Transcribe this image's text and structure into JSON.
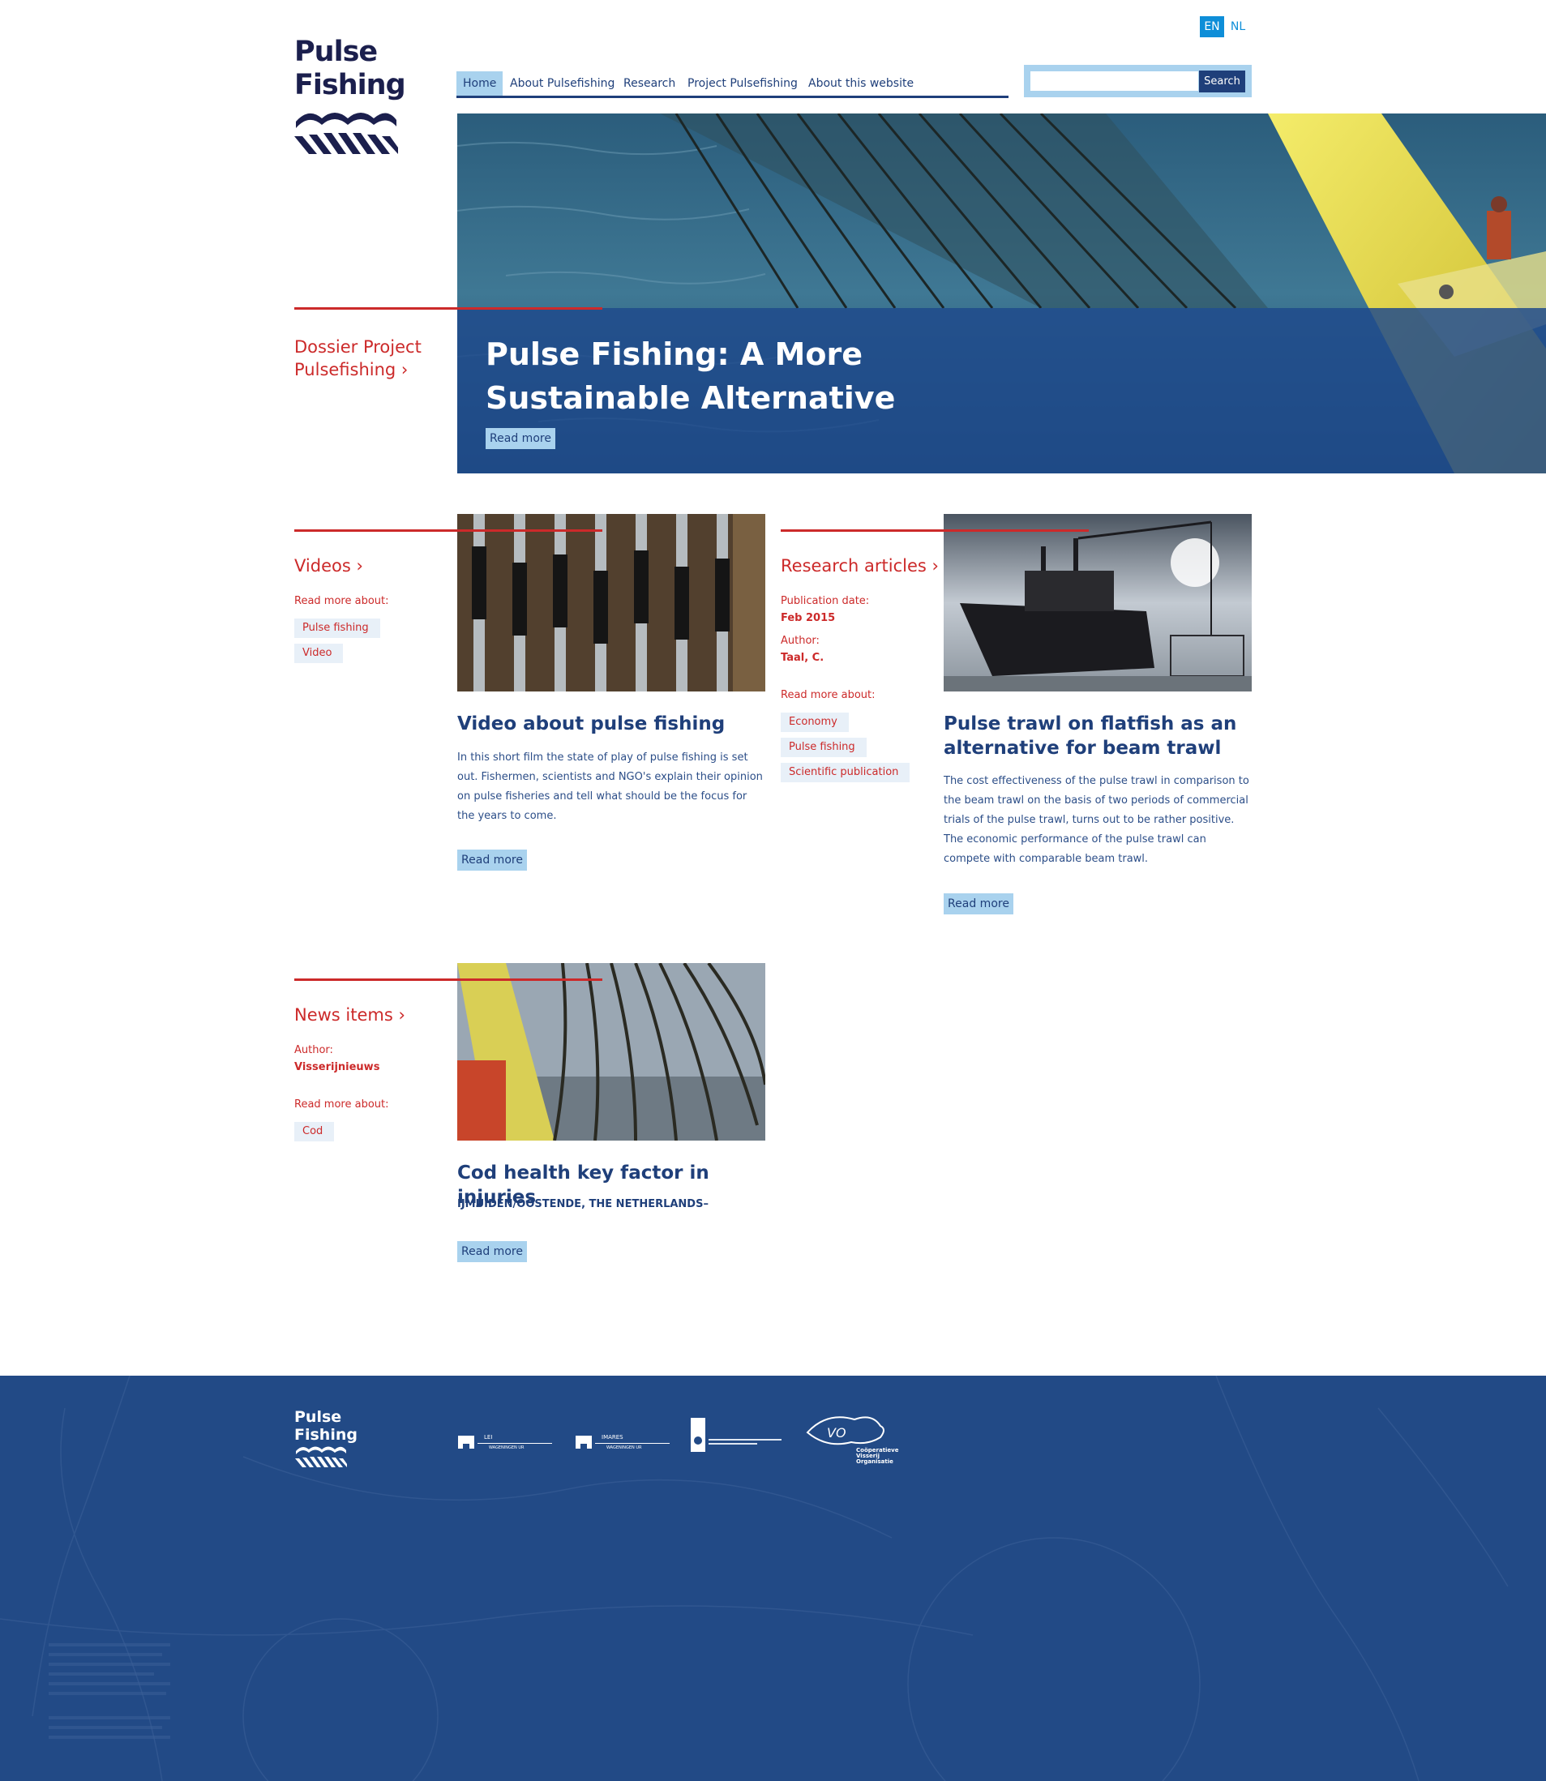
{
  "site": {
    "logo_line1": "Pulse",
    "logo_line2": "Fishing"
  },
  "language": {
    "en": "EN",
    "nl": "NL",
    "active": "EN"
  },
  "nav": {
    "items": [
      {
        "label": "Home",
        "active": true
      },
      {
        "label": "About Pulsefishing"
      },
      {
        "label": "Research"
      },
      {
        "label": "Project Pulsefishing"
      },
      {
        "label": "About this website"
      }
    ]
  },
  "search": {
    "value": "",
    "button_label": "Search"
  },
  "hero": {
    "side_link": "Dossier Project Pulsefishing ›",
    "title_line1": "Pulse Fishing: A More",
    "title_line2": "Sustainable Alternative",
    "read_more": "Read more"
  },
  "videos": {
    "heading": "Videos ›",
    "read_more_about_label": "Read more about:",
    "tags": [
      "Pulse fishing",
      "Video"
    ],
    "title": "Video about pulse fishing",
    "text": "In this short film the state of play of pulse fishing is set out. Fishermen, scientists and NGO's explain their opinion on pulse fisheries and tell what should be the focus for the years to come.",
    "read_more": "Read more"
  },
  "research": {
    "heading": "Research articles ›",
    "publication_date_label": "Publication date:",
    "publication_date": "Feb 2015",
    "author_label": "Author:",
    "author": "Taal, C.",
    "read_more_about_label": "Read more about:",
    "tags": [
      "Economy",
      "Pulse fishing",
      "Scientific publication"
    ],
    "title_line1": "Pulse trawl on flatfish as an",
    "title_line2": "alternative for beam trawl",
    "text": "The cost effectiveness of the pulse trawl in comparison to the beam trawl on the basis of two periods of commercial trials of the pulse trawl, turns out to be rather positive. The economic performance of the pulse trawl can compete with comparable beam trawl.",
    "read_more": "Read more"
  },
  "news": {
    "heading": "News items ›",
    "author_label": "Author:",
    "author": "Visserijnieuws",
    "read_more_about_label": "Read more about:",
    "tags": [
      "Cod"
    ],
    "title": "Cod health key factor in injuries",
    "dateline": "IJMUIDEN/OOSTENDE, THE NETHERLANDS–",
    "read_more": "Read more"
  },
  "footer": {
    "logo_line1": "Pulse",
    "logo_line2": "Fishing",
    "partners": [
      {
        "name": "LEI WAGENINGEN UR"
      },
      {
        "name": "IMARES WAGENINGEN UR"
      },
      {
        "name": "Ministerie van Economische Zaken, Landbouw en Innovatie"
      },
      {
        "name": "Coöperatieve Visserij Organisatie"
      }
    ]
  },
  "colors": {
    "navy": "#1f3f7a",
    "accent_red": "#cc2a2a",
    "light_blue": "#a9d2ee",
    "lang_blue": "#0e8ed8",
    "footer_bg": "#224a86"
  },
  "icons": [
    "waves-logo-icon",
    "hero-trawl-photo",
    "video-thumbnail",
    "trawler-photo",
    "nets-photo"
  ]
}
